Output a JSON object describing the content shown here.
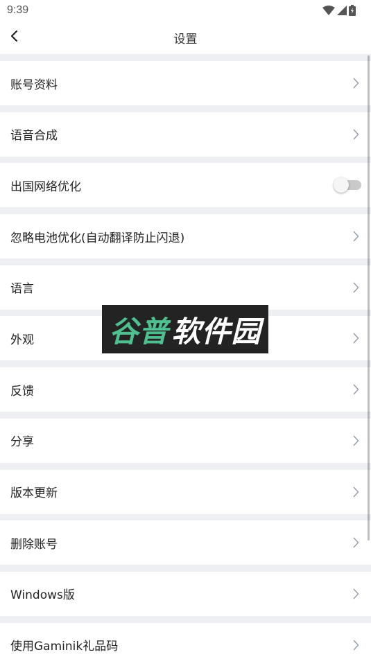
{
  "status_bar": {
    "time": "9:39",
    "icons": [
      "wifi-icon",
      "cell-signal-icon",
      "battery-charging-icon"
    ]
  },
  "nav": {
    "title": "设置",
    "back_icon": "chevron-left-icon"
  },
  "settings": {
    "items": [
      {
        "label": "账号资料",
        "control": "chevron"
      },
      {
        "label": "语音合成",
        "control": "chevron"
      },
      {
        "label": "出国网络优化",
        "control": "toggle",
        "toggle_on": false
      },
      {
        "label": "忽略电池优化(自动翻译防止闪退)",
        "control": "chevron"
      },
      {
        "label": "语言",
        "control": "chevron"
      },
      {
        "label": "外观",
        "control": "chevron"
      },
      {
        "label": "反馈",
        "control": "chevron"
      },
      {
        "label": "分享",
        "control": "chevron"
      },
      {
        "label": "版本更新",
        "control": "chevron"
      },
      {
        "label": "删除账号",
        "control": "chevron"
      },
      {
        "label": "Windows版",
        "control": "chevron"
      },
      {
        "label": "使用Gaminik礼品码",
        "control": "chevron"
      }
    ]
  },
  "watermark": {
    "part_green": "谷普",
    "part_white": "软件园"
  },
  "colors": {
    "background": "#eeeff3",
    "row_background": "#ffffff",
    "chevron": "#9aa0aa",
    "watermark_green": "#4ec08f",
    "watermark_bg": "#232323"
  }
}
